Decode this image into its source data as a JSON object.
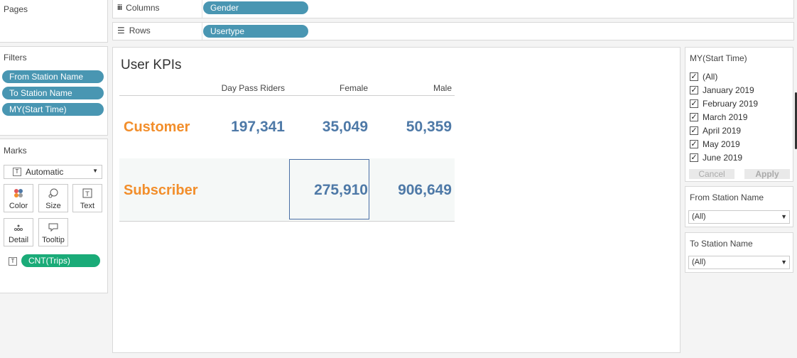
{
  "pages": {
    "title": "Pages"
  },
  "columns_shelf": {
    "label": "Columns",
    "pill": "Gender"
  },
  "rows_shelf": {
    "label": "Rows",
    "pill": "Usertype"
  },
  "filters": {
    "title": "Filters",
    "items": [
      "From Station Name",
      "To Station Name",
      "MY(Start Time)"
    ]
  },
  "marks": {
    "title": "Marks",
    "type": "Automatic",
    "buttons": {
      "color": "Color",
      "size": "Size",
      "text": "Text",
      "detail": "Detail",
      "tooltip": "Tooltip"
    },
    "field_pill": "CNT(Trips)"
  },
  "view": {
    "title": "User KPIs",
    "columns": [
      "Day Pass Riders",
      "Female",
      "Male"
    ],
    "rows": [
      {
        "label": "Customer",
        "values": [
          "197,341",
          "35,049",
          "50,359"
        ]
      },
      {
        "label": "Subscriber",
        "values": [
          "",
          "275,910",
          "906,649"
        ]
      }
    ]
  },
  "time_filter": {
    "title": "MY(Start Time)",
    "options": [
      "(All)",
      "January 2019",
      "February 2019",
      "March 2019",
      "April 2019",
      "May 2019",
      "June 2019"
    ],
    "cancel": "Cancel",
    "apply": "Apply"
  },
  "from_station_filter": {
    "title": "From Station Name",
    "value": "(All)"
  },
  "to_station_filter": {
    "title": "To Station Name",
    "value": "(All)"
  },
  "colors": {
    "pill_blue": "#4996b2",
    "pill_green": "#1aab78",
    "row_label": "#f28e2b",
    "value": "#4e79a7"
  }
}
